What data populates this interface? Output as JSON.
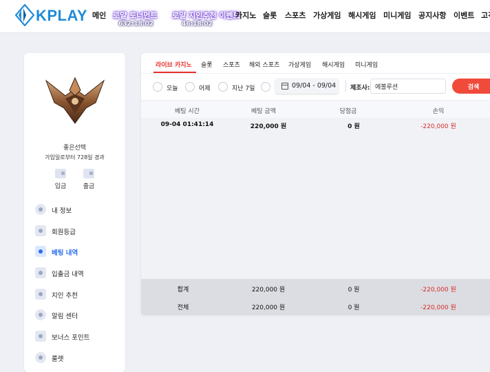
{
  "brand": {
    "name": "KPLAY",
    "color": "#1f8bd6",
    "accent": "#e8302b"
  },
  "header": {
    "nav": [
      {
        "label": "메인"
      },
      {
        "label": "로얄 토너먼트",
        "sub": "632:18:02"
      },
      {
        "label": "로얄 지인추천 이벤트",
        "sub": "46:18:02"
      },
      {
        "label": "카지노"
      },
      {
        "label": "슬롯"
      },
      {
        "label": "스포츠"
      },
      {
        "label": "가상게임"
      },
      {
        "label": "해시게임"
      },
      {
        "label": "미니게임"
      },
      {
        "label": "공지사항"
      },
      {
        "label": "이벤트"
      },
      {
        "label": "고객"
      }
    ]
  },
  "sidebar": {
    "emblem_icon": "rank-emblem-icon",
    "nickname": "좋은선택",
    "joined_text": "가입일로부터 728일 경과",
    "deposit_label": "입금",
    "withdraw_label": "출금",
    "menu": [
      {
        "label": "내 정보",
        "icon": "profile-icon"
      },
      {
        "label": "회원등급",
        "icon": "level-icon"
      },
      {
        "label": "베팅 내역",
        "icon": "history-icon",
        "active": true
      },
      {
        "label": "입출금 내역",
        "icon": "wallet-icon"
      },
      {
        "label": "지인 추천",
        "icon": "heart-icon"
      },
      {
        "label": "알림 센터",
        "icon": "bell-icon"
      },
      {
        "label": "보너스 포인트",
        "icon": "gift-icon"
      },
      {
        "label": "룰렛",
        "icon": "roulette-icon"
      }
    ]
  },
  "tabs": [
    "라이브 카지노",
    "슬롯",
    "스포츠",
    "해외 스포츠",
    "가상게임",
    "해시게임",
    "미니게임"
  ],
  "filter": {
    "periods": [
      "오늘",
      "어제",
      "지난 7일",
      ""
    ],
    "date_range": "09/04 - 09/04",
    "maker_label": "제조사:",
    "maker_value": "에볼루션",
    "search_label": "검색"
  },
  "table": {
    "headers": [
      "베팅 시간",
      "베팅 금액",
      "당첨금",
      "손익"
    ],
    "rows": [
      [
        "09-04 01:41:14",
        "220,000 원",
        "0 원",
        "-220,000 원"
      ]
    ],
    "footer": [
      [
        "합계",
        "220,000 원",
        "0 원",
        "-220,000 원"
      ],
      [
        "전체",
        "220,000 원",
        "0 원",
        "-220,000 원"
      ]
    ]
  }
}
